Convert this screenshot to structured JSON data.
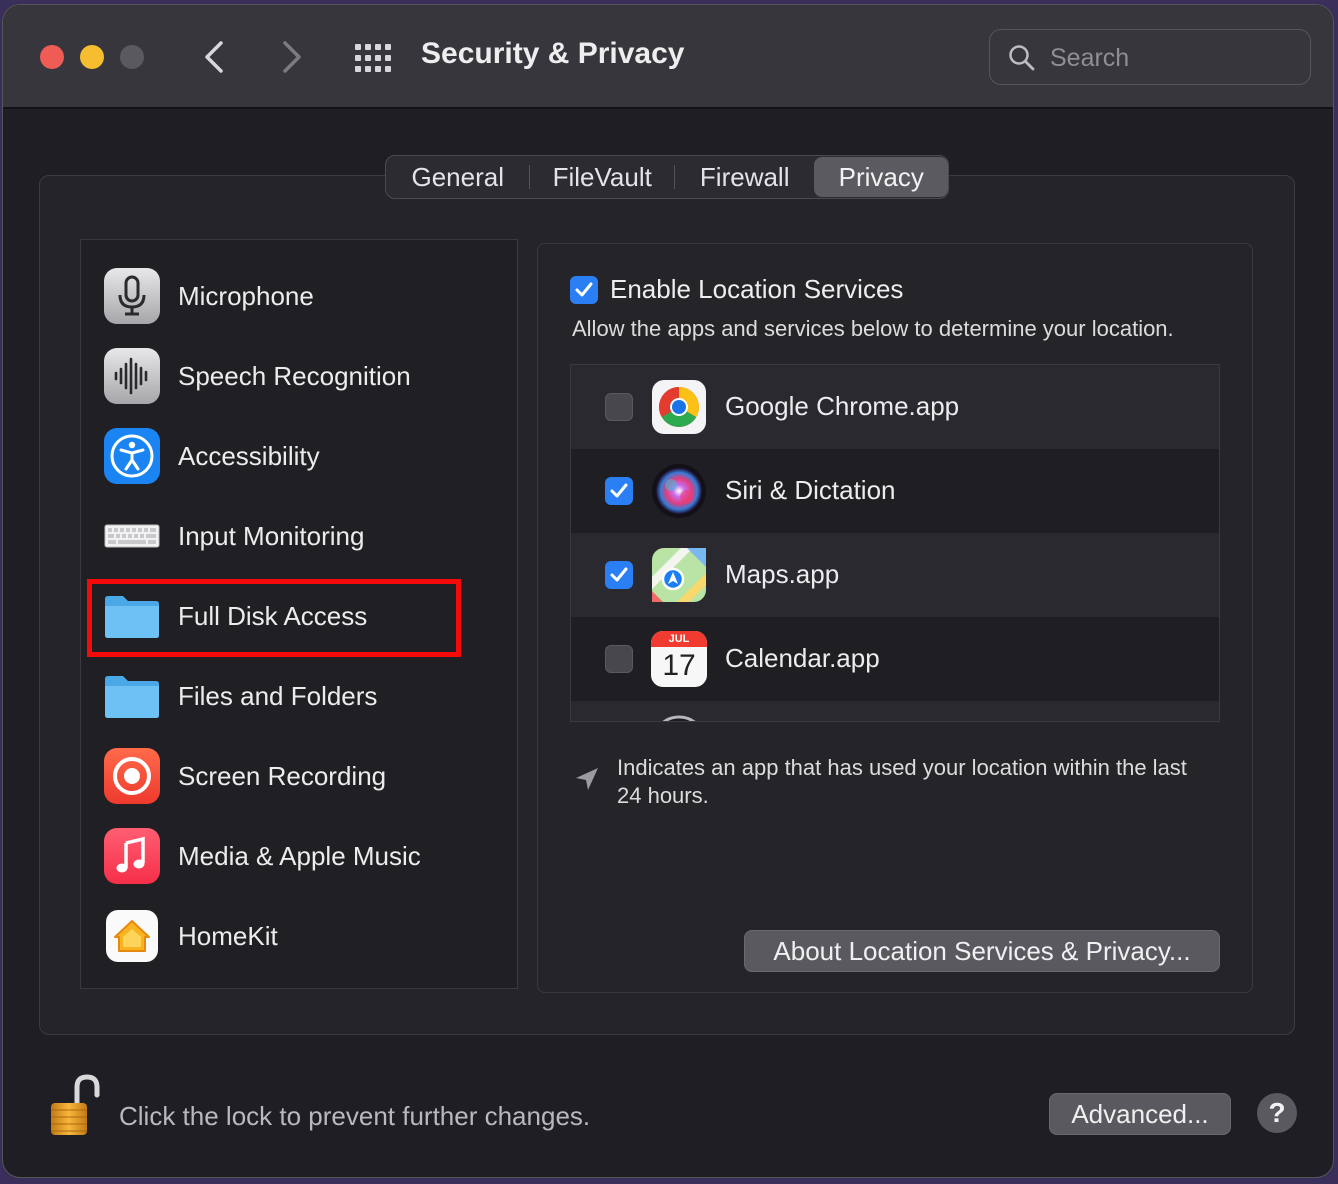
{
  "window": {
    "title": "Security & Privacy",
    "search_placeholder": "Search"
  },
  "tabs": [
    {
      "label": "General",
      "selected": false
    },
    {
      "label": "FileVault",
      "selected": false
    },
    {
      "label": "Firewall",
      "selected": false
    },
    {
      "label": "Privacy",
      "selected": true
    }
  ],
  "sidebar": {
    "items": [
      {
        "label": "Microphone",
        "icon": "microphone-icon"
      },
      {
        "label": "Speech Recognition",
        "icon": "waveform-icon"
      },
      {
        "label": "Accessibility",
        "icon": "accessibility-icon"
      },
      {
        "label": "Input Monitoring",
        "icon": "keyboard-icon"
      },
      {
        "label": "Full Disk Access",
        "icon": "folder-icon"
      },
      {
        "label": "Files and Folders",
        "icon": "folder-icon"
      },
      {
        "label": "Screen Recording",
        "icon": "record-icon"
      },
      {
        "label": "Media & Apple Music",
        "icon": "music-note-icon"
      },
      {
        "label": "HomeKit",
        "icon": "home-icon"
      }
    ]
  },
  "location": {
    "enable_label": "Enable Location Services",
    "enabled": true,
    "description": "Allow the apps and services below to determine your location.",
    "apps": [
      {
        "label": "Google Chrome.app",
        "checked": false,
        "icon": "chrome-icon"
      },
      {
        "label": "Siri & Dictation",
        "checked": true,
        "icon": "siri-icon"
      },
      {
        "label": "Maps.app",
        "checked": true,
        "icon": "maps-icon"
      },
      {
        "label": "Calendar.app",
        "checked": false,
        "icon": "calendar-icon",
        "month": "JUL",
        "day": "17"
      }
    ],
    "note": "Indicates an app that has used your location within the last 24 hours.",
    "about_button": "About Location Services & Privacy..."
  },
  "footer": {
    "lock_text": "Click the lock to prevent further changes.",
    "advanced_button": "Advanced...",
    "help_button": "?"
  },
  "colors": {
    "accent": "#2b7ff5",
    "highlight": "#f50a0a"
  }
}
